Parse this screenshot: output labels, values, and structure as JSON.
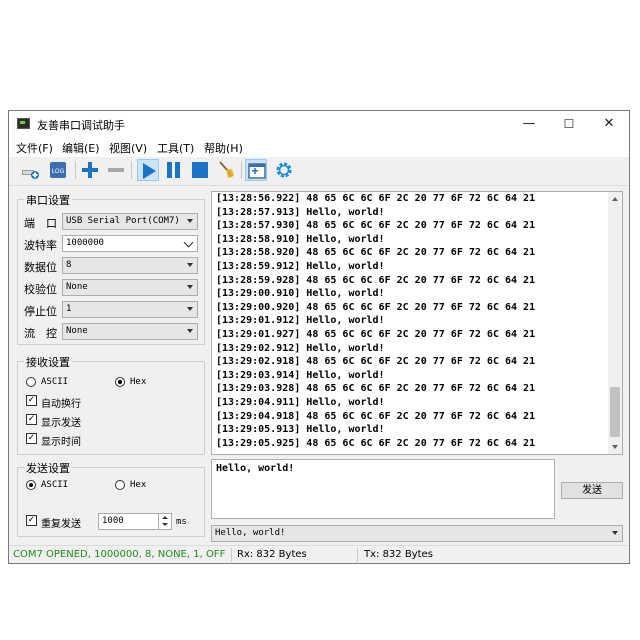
{
  "window": {
    "title": "友善串口调试助手",
    "controls": {
      "minimize": "—",
      "maximize": "☐",
      "close": "✕"
    }
  },
  "menu": [
    "文件(F)",
    "编辑(E)",
    "视图(V)",
    "工具(T)",
    "帮助(H)"
  ],
  "toolbar": {
    "icons": [
      "new-session-icon",
      "log-icon",
      "add-icon",
      "remove-icon",
      "play-icon",
      "pause-icon",
      "stop-icon",
      "clear-broom-icon",
      "add-window-icon",
      "settings-gear-icon"
    ],
    "log_label": "LOG",
    "accent": "#1a73c9"
  },
  "serial_settings": {
    "title": "串口设置",
    "fields": [
      {
        "label": "端　口",
        "value": "USB Serial Port(COM7)"
      },
      {
        "label": "波特率",
        "value": "1000000"
      },
      {
        "label": "数据位",
        "value": "8"
      },
      {
        "label": "校验位",
        "value": "None"
      },
      {
        "label": "停止位",
        "value": "1"
      },
      {
        "label": "流　控",
        "value": "None"
      }
    ]
  },
  "receive_settings": {
    "title": "接收设置",
    "ascii_label": "ASCII",
    "hex_label": "Hex",
    "selected": "Hex",
    "checks": [
      {
        "label": "自动换行",
        "checked": true
      },
      {
        "label": "显示发送",
        "checked": true
      },
      {
        "label": "显示时间",
        "checked": true
      }
    ]
  },
  "send_settings": {
    "title": "发送设置",
    "ascii_label": "ASCII",
    "hex_label": "Hex",
    "selected": "ASCII",
    "repeat_label": "重复发送",
    "repeat_checked": true,
    "interval": "1000",
    "unit": "ms"
  },
  "receive_log": [
    "[13:28:56.922] 48 65 6C 6C 6F 2C 20 77 6F 72 6C 64 21",
    "[13:28:57.913] Hello, world!",
    "[13:28:57.930] 48 65 6C 6C 6F 2C 20 77 6F 72 6C 64 21",
    "[13:28:58.910] Hello, world!",
    "[13:28:58.920] 48 65 6C 6C 6F 2C 20 77 6F 72 6C 64 21",
    "[13:28:59.912] Hello, world!",
    "[13:28:59.928] 48 65 6C 6C 6F 2C 20 77 6F 72 6C 64 21",
    "[13:29:00.910] Hello, world!",
    "[13:29:00.920] 48 65 6C 6C 6F 2C 20 77 6F 72 6C 64 21",
    "[13:29:01.912] Hello, world!",
    "[13:29:01.927] 48 65 6C 6C 6F 2C 20 77 6F 72 6C 64 21",
    "[13:29:02.912] Hello, world!",
    "[13:29:02.918] 48 65 6C 6C 6F 2C 20 77 6F 72 6C 64 21",
    "[13:29:03.914] Hello, world!",
    "[13:29:03.928] 48 65 6C 6C 6F 2C 20 77 6F 72 6C 64 21",
    "[13:29:04.911] Hello, world!",
    "[13:29:04.918] 48 65 6C 6C 6F 2C 20 77 6F 72 6C 64 21",
    "[13:29:05.913] Hello, world!",
    "[13:29:05.925] 48 65 6C 6C 6F 2C 20 77 6F 72 6C 64 21"
  ],
  "send_text": "Hello, world!",
  "send_button": "发送",
  "history_value": "Hello, world!",
  "status": {
    "port": "COM7 OPENED, 1000000, 8, NONE, 1, OFF",
    "rx": "Rx: 832 Bytes",
    "tx": "Tx: 832 Bytes",
    "port_color": "#1e8c1e"
  }
}
